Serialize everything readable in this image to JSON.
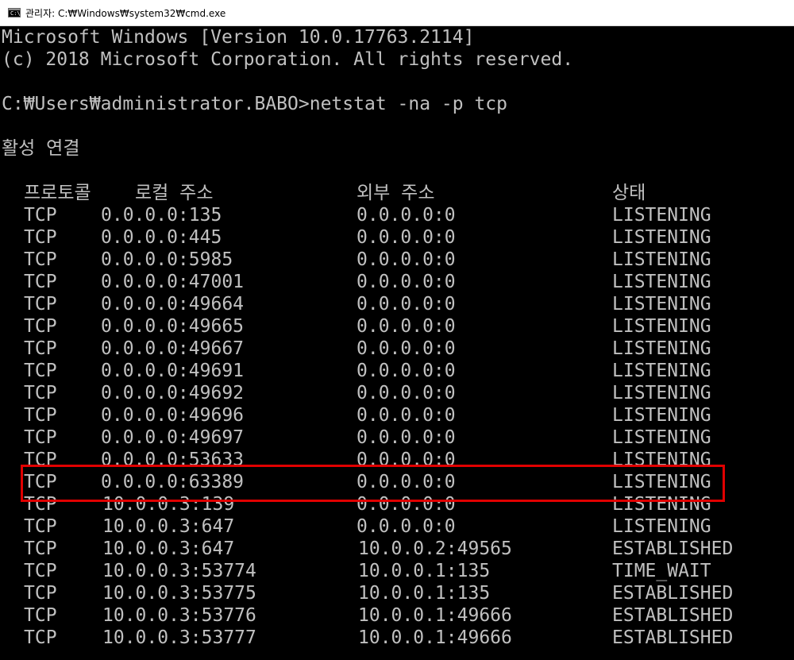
{
  "window": {
    "title": "관리자: C:₩Windows₩system32₩cmd.exe",
    "icon": "console-app-icon",
    "icon_glyph": "C:\\"
  },
  "console": {
    "banner_line1": "Microsoft Windows [Version 10.0.17763.2114]",
    "banner_line2": "(c) 2018 Microsoft Corporation. All rights reserved.",
    "prompt": "C:₩Users₩administrator.BABO>",
    "command": "netstat -na -p tcp",
    "section_title": "활성 연결",
    "headers": {
      "proto": "프로토콜",
      "local": "로컬 주소",
      "foreign": "외부 주소",
      "state": "상태"
    },
    "rows": [
      {
        "proto": "TCP",
        "local": "0.0.0.0:135",
        "foreign": "0.0.0.0:0",
        "state": "LISTENING"
      },
      {
        "proto": "TCP",
        "local": "0.0.0.0:445",
        "foreign": "0.0.0.0:0",
        "state": "LISTENING"
      },
      {
        "proto": "TCP",
        "local": "0.0.0.0:5985",
        "foreign": "0.0.0.0:0",
        "state": "LISTENING"
      },
      {
        "proto": "TCP",
        "local": "0.0.0.0:47001",
        "foreign": "0.0.0.0:0",
        "state": "LISTENING"
      },
      {
        "proto": "TCP",
        "local": "0.0.0.0:49664",
        "foreign": "0.0.0.0:0",
        "state": "LISTENING"
      },
      {
        "proto": "TCP",
        "local": "0.0.0.0:49665",
        "foreign": "0.0.0.0:0",
        "state": "LISTENING"
      },
      {
        "proto": "TCP",
        "local": "0.0.0.0:49667",
        "foreign": "0.0.0.0:0",
        "state": "LISTENING"
      },
      {
        "proto": "TCP",
        "local": "0.0.0.0:49691",
        "foreign": "0.0.0.0:0",
        "state": "LISTENING"
      },
      {
        "proto": "TCP",
        "local": "0.0.0.0:49692",
        "foreign": "0.0.0.0:0",
        "state": "LISTENING"
      },
      {
        "proto": "TCP",
        "local": "0.0.0.0:49696",
        "foreign": "0.0.0.0:0",
        "state": "LISTENING"
      },
      {
        "proto": "TCP",
        "local": "0.0.0.0:49697",
        "foreign": "0.0.0.0:0",
        "state": "LISTENING"
      },
      {
        "proto": "TCP",
        "local": "0.0.0.0:53633",
        "foreign": "0.0.0.0:0",
        "state": "LISTENING"
      },
      {
        "proto": "TCP",
        "local": "0.0.0.0:63389",
        "foreign": "0.0.0.0:0",
        "state": "LISTENING"
      },
      {
        "proto": "TCP",
        "local": "10.0.0.3:139",
        "foreign": "0.0.0.0:0",
        "state": "LISTENING"
      },
      {
        "proto": "TCP",
        "local": "10.0.0.3:647",
        "foreign": "0.0.0.0:0",
        "state": "LISTENING"
      },
      {
        "proto": "TCP",
        "local": "10.0.0.3:647",
        "foreign": "10.0.0.2:49565",
        "state": "ESTABLISHED"
      },
      {
        "proto": "TCP",
        "local": "10.0.0.3:53774",
        "foreign": "10.0.0.1:135",
        "state": "TIME_WAIT"
      },
      {
        "proto": "TCP",
        "local": "10.0.0.3:53775",
        "foreign": "10.0.0.1:135",
        "state": "ESTABLISHED"
      },
      {
        "proto": "TCP",
        "local": "10.0.0.3:53776",
        "foreign": "10.0.0.1:49666",
        "state": "ESTABLISHED"
      },
      {
        "proto": "TCP",
        "local": "10.0.0.3:53777",
        "foreign": "10.0.0.1:49666",
        "state": "ESTABLISHED"
      }
    ],
    "highlighted_row_local": "0.0.0.0:63389"
  },
  "colors": {
    "console_background": "#000000",
    "console_text": "#c0c0c0",
    "highlight_border": "#e00000",
    "titlebar_background": "#ffffff"
  }
}
